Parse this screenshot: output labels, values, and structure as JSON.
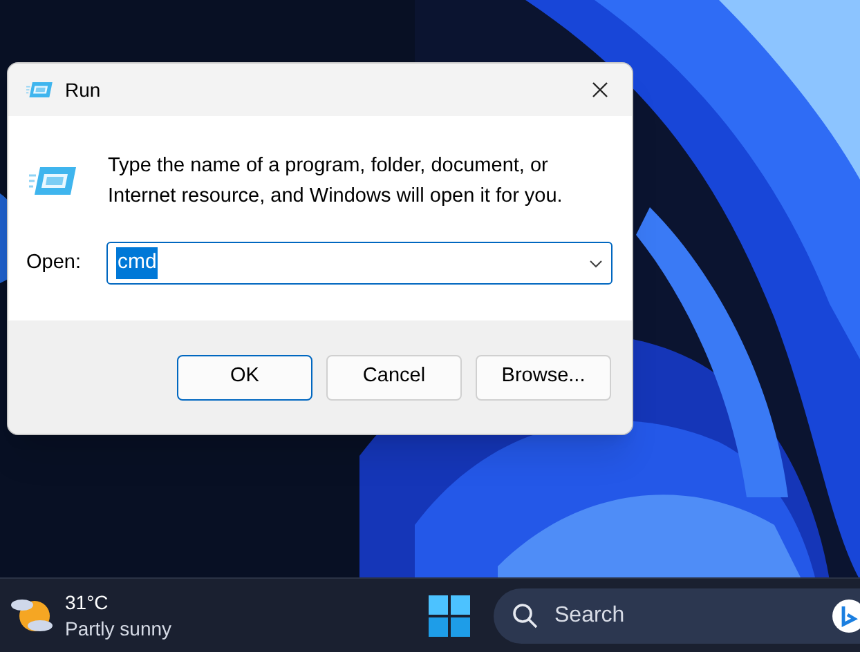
{
  "dialog": {
    "title": "Run",
    "message_lines": [
      "Type the name of a program, folder, document, or",
      "Internet resource, and Windows will open it for you."
    ],
    "open_label": "Open:",
    "open_field": {
      "value": "cmd",
      "selected": true
    },
    "buttons": [
      {
        "label": "OK",
        "default": true
      },
      {
        "label": "Cancel",
        "default": false
      },
      {
        "label": "Browse...",
        "default": false
      }
    ]
  },
  "taskbar": {
    "weather": {
      "temperature": "31°C",
      "condition": "Partly sunny"
    },
    "search": {
      "placeholder": "Search"
    }
  }
}
